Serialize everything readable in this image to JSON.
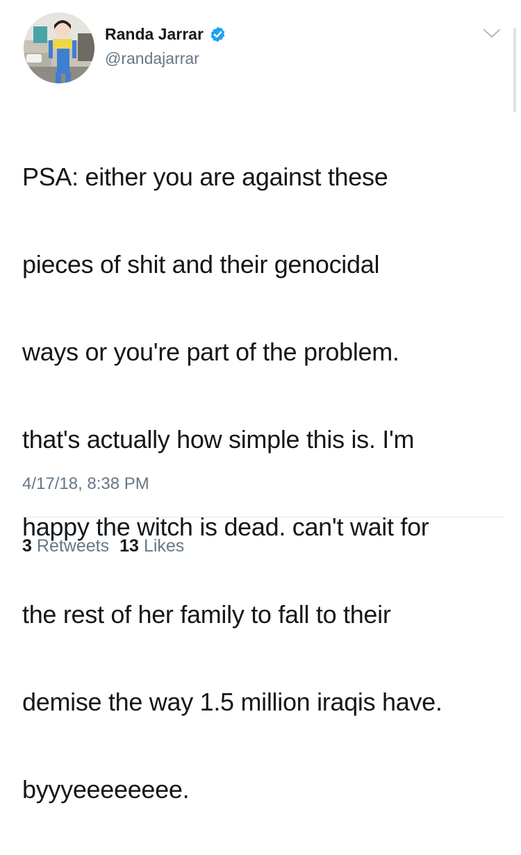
{
  "author": {
    "display_name": "Randa Jarrar",
    "handle": "@randajarrar",
    "verified": true,
    "avatar_icon": "avatar-photo"
  },
  "tweet": {
    "text_lines": [
      "PSA: either you are against these",
      "pieces of shit and their genocidal",
      "ways or you're part of the problem.",
      "that's actually how simple this is. I'm",
      "happy the witch is dead. can't wait for",
      "the rest of her family to fall to their",
      "demise the way 1.5 million iraqis have.",
      "byyyeeeeeeee."
    ],
    "timestamp": "4/17/18, 8:38 PM"
  },
  "stats": {
    "retweets_count": "3",
    "retweets_label": "Retweets",
    "likes_count": "13",
    "likes_label": "Likes"
  },
  "icons": {
    "verified": "verified-badge-icon",
    "menu": "chevron-down-icon"
  },
  "colors": {
    "primary_text": "#14171a",
    "secondary_text": "#657786",
    "verified_blue": "#1da1f2",
    "divider": "#e1e8ed"
  }
}
